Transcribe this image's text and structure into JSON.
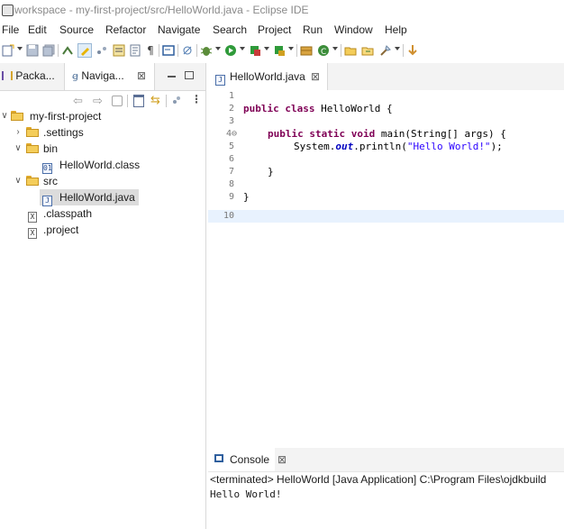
{
  "window": {
    "title": "workspace - my-first-project/src/HelloWorld.java - Eclipse IDE"
  },
  "menu": [
    "File",
    "Edit",
    "Source",
    "Refactor",
    "Navigate",
    "Search",
    "Project",
    "Run",
    "Window",
    "Help"
  ],
  "left_view": {
    "tabs": [
      {
        "label": "Packa...",
        "icon": "package-explorer-icon"
      },
      {
        "label": "Naviga...",
        "icon": "navigator-icon",
        "close": "⊠"
      }
    ],
    "tree": [
      {
        "label": "my-first-project",
        "icon": "project-icon",
        "expanded": true
      },
      {
        "label": ".settings",
        "icon": "folder-icon",
        "expanded": false
      },
      {
        "label": "bin",
        "icon": "folder-icon",
        "expanded": true
      },
      {
        "label": "HelloWorld.class",
        "icon": "class-file-icon"
      },
      {
        "label": "src",
        "icon": "folder-icon",
        "expanded": true
      },
      {
        "label": "HelloWorld.java",
        "icon": "java-file-icon",
        "selected": true
      },
      {
        "label": ".classpath",
        "icon": "xml-file-icon"
      },
      {
        "label": ".project",
        "icon": "xml-file-icon"
      }
    ]
  },
  "editor": {
    "tab_label": "HelloWorld.java",
    "tab_close": "⊠",
    "line_numbers": [
      "1",
      "2",
      "3",
      "4⊖",
      "5",
      "6",
      "7",
      "8",
      "9",
      "10"
    ],
    "code": {
      "l2_kw": "public class",
      "l2_rest": " HelloWorld {",
      "l4_kw": "public static void",
      "l4_rest": " main(String[] args) {",
      "l5_pre": "System.",
      "l5_static": "out",
      "l5_mid": ".println(",
      "l5_str": "\"Hello World!\"",
      "l5_end": ");",
      "l7": "}",
      "l9": "}"
    },
    "hscroll_arrow": "<"
  },
  "console": {
    "tab_label": "Console",
    "tab_close": "⊠",
    "status": "<terminated> HelloWorld [Java Application] C:\\Program Files\\ojdkbuild",
    "output": "Hello World!"
  }
}
